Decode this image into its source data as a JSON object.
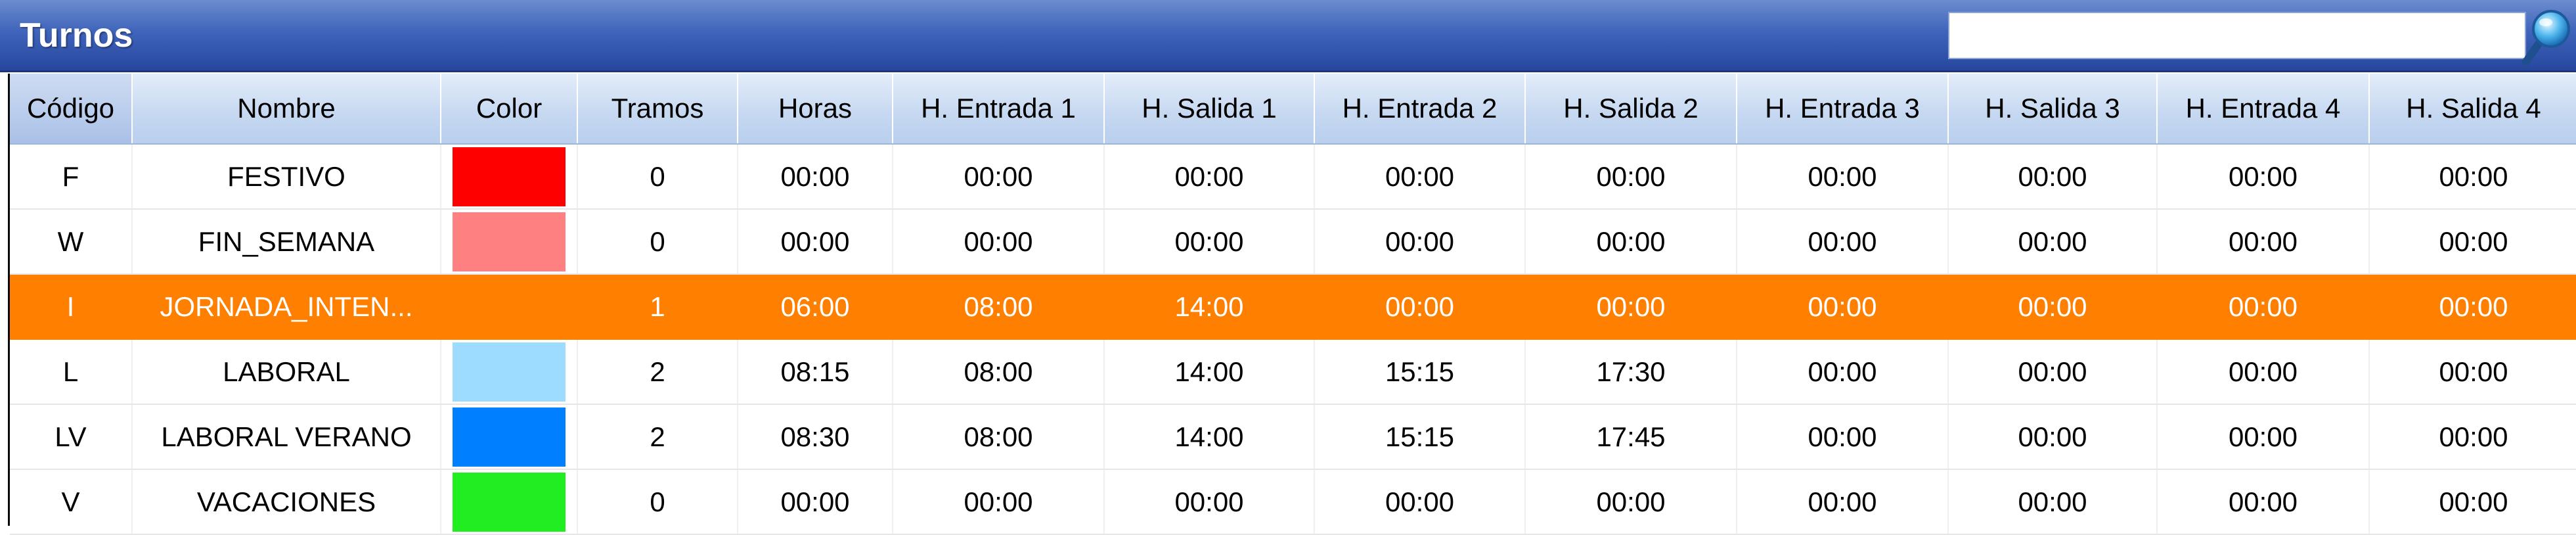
{
  "panel": {
    "title": "Turnos",
    "search": {
      "value": "",
      "placeholder": ""
    }
  },
  "columns": [
    "Código",
    "Nombre",
    "Color",
    "Tramos",
    "Horas",
    "H. Entrada 1",
    "H. Salida 1",
    "H. Entrada 2",
    "H. Salida 2",
    "H. Entrada 3",
    "H. Salida 3",
    "H. Entrada 4",
    "H. Salida 4"
  ],
  "rows": [
    {
      "codigo": "F",
      "nombre": "FESTIVO",
      "color": "#ff0000",
      "tramos": "0",
      "horas": "00:00",
      "e1": "00:00",
      "s1": "00:00",
      "e2": "00:00",
      "s2": "00:00",
      "e3": "00:00",
      "s3": "00:00",
      "e4": "00:00",
      "s4": "00:00"
    },
    {
      "codigo": "W",
      "nombre": "FIN_SEMANA",
      "color": "#ff8080",
      "tramos": "0",
      "horas": "00:00",
      "e1": "00:00",
      "s1": "00:00",
      "e2": "00:00",
      "s2": "00:00",
      "e3": "00:00",
      "s3": "00:00",
      "e4": "00:00",
      "s4": "00:00"
    },
    {
      "codigo": "I",
      "nombre": "JORNADA_INTEN...",
      "color": "#ff8000",
      "tramos": "1",
      "horas": "06:00",
      "e1": "08:00",
      "s1": "14:00",
      "e2": "00:00",
      "s2": "00:00",
      "e3": "00:00",
      "s3": "00:00",
      "e4": "00:00",
      "s4": "00:00",
      "selected": true
    },
    {
      "codigo": "L",
      "nombre": "LABORAL",
      "color": "#9edcff",
      "tramos": "2",
      "horas": "08:15",
      "e1": "08:00",
      "s1": "14:00",
      "e2": "15:15",
      "s2": "17:30",
      "e3": "00:00",
      "s3": "00:00",
      "e4": "00:00",
      "s4": "00:00"
    },
    {
      "codigo": "LV",
      "nombre": "LABORAL VERANO",
      "color": "#0080ff",
      "tramos": "2",
      "horas": "08:30",
      "e1": "08:00",
      "s1": "14:00",
      "e2": "15:15",
      "s2": "17:45",
      "e3": "00:00",
      "s3": "00:00",
      "e4": "00:00",
      "s4": "00:00"
    },
    {
      "codigo": "V",
      "nombre": "VACACIONES",
      "color": "#20ee20",
      "tramos": "0",
      "horas": "00:00",
      "e1": "00:00",
      "s1": "00:00",
      "e2": "00:00",
      "s2": "00:00",
      "e3": "00:00",
      "s3": "00:00",
      "e4": "00:00",
      "s4": "00:00"
    }
  ],
  "colors": {
    "selected_row": "#ff8000",
    "title_bar": "#3f64ba",
    "header": "#c7d9f1"
  },
  "icons": {
    "search": "search-icon"
  }
}
